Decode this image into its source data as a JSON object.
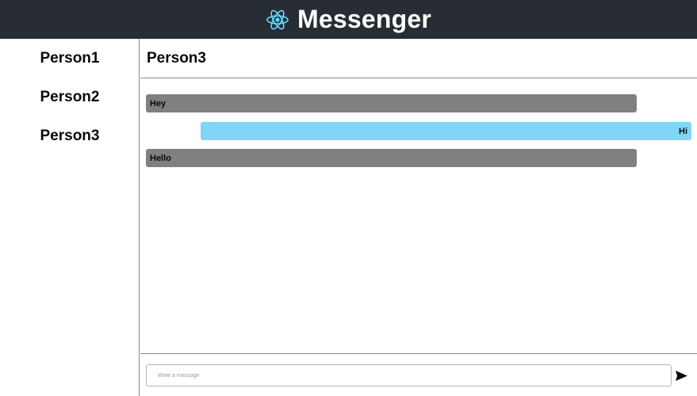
{
  "header": {
    "title": "Messenger",
    "logo_icon": "react-atom-icon",
    "background": "#282c34",
    "logo_color": "#61dafb"
  },
  "sidebar": {
    "contacts": [
      {
        "label": "Person1"
      },
      {
        "label": "Person2"
      },
      {
        "label": "Person3"
      }
    ]
  },
  "chat": {
    "recipient": "Person3",
    "messages": [
      {
        "text": "Hey",
        "direction": "incoming",
        "color": "#808080"
      },
      {
        "text": "Hi",
        "direction": "outgoing",
        "color": "#7fd6f7"
      },
      {
        "text": "Hello",
        "direction": "incoming",
        "color": "#808080"
      }
    ]
  },
  "composer": {
    "placeholder": "Write a message",
    "value": "",
    "send_icon": "send-arrow-icon"
  }
}
